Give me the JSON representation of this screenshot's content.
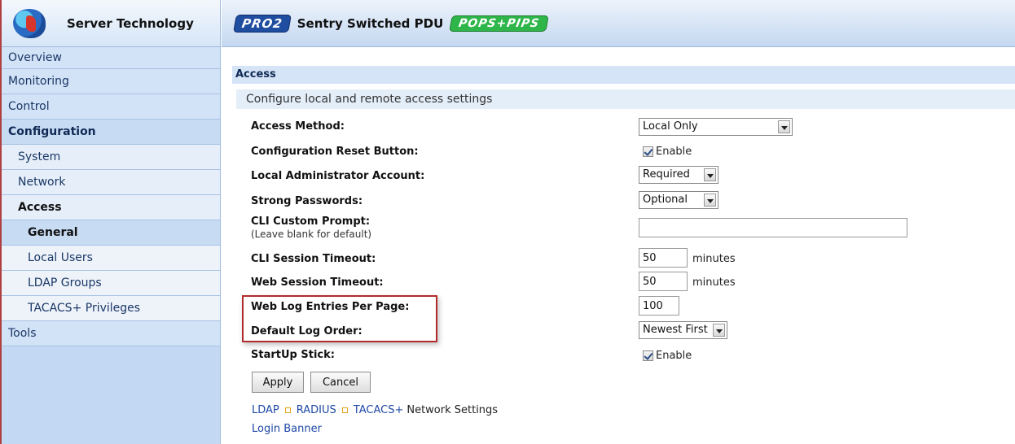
{
  "brand": {
    "name": "Server Technology"
  },
  "header": {
    "pro_badge": "PRO2",
    "title": "Sentry Switched PDU",
    "pops_badge": "POPS+PIPS"
  },
  "sidebar": {
    "items": [
      {
        "label": "Overview"
      },
      {
        "label": "Monitoring"
      },
      {
        "label": "Control"
      },
      {
        "label": "Configuration"
      },
      {
        "label": "System"
      },
      {
        "label": "Network"
      },
      {
        "label": "Access"
      },
      {
        "label": "General"
      },
      {
        "label": "Local Users"
      },
      {
        "label": "LDAP Groups"
      },
      {
        "label": "TACACS+ Privileges"
      },
      {
        "label": "Tools"
      }
    ]
  },
  "main": {
    "section_title": "Access",
    "section_subtitle": "Configure local and remote access settings",
    "fields": {
      "access_method": {
        "label": "Access Method:",
        "value": "Local Only"
      },
      "config_reset": {
        "label": "Configuration Reset Button:",
        "checkbox_label": "Enable",
        "checked": true
      },
      "local_admin": {
        "label": "Local Administrator Account:",
        "value": "Required"
      },
      "strong_pw": {
        "label": "Strong Passwords:",
        "value": "Optional"
      },
      "cli_prompt": {
        "label": "CLI Custom Prompt:",
        "hint": "(Leave blank for default)",
        "value": ""
      },
      "cli_timeout": {
        "label": "CLI Session Timeout:",
        "value": "50",
        "unit": "minutes"
      },
      "web_timeout": {
        "label": "Web Session Timeout:",
        "value": "50",
        "unit": "minutes"
      },
      "log_entries": {
        "label": "Web Log Entries Per Page:",
        "value": "100"
      },
      "log_order": {
        "label": "Default Log Order:",
        "value": "Newest First"
      },
      "startup_stick": {
        "label": "StartUp Stick:",
        "checkbox_label": "Enable",
        "checked": true
      }
    },
    "buttons": {
      "apply": "Apply",
      "cancel": "Cancel"
    },
    "links": {
      "ldap": "LDAP",
      "radius": "RADIUS",
      "tacacs": "TACACS+",
      "suffix": "Network Settings",
      "login_banner": "Login Banner"
    }
  },
  "colors": {
    "highlight": "#b22b2b",
    "link": "#1f49a5",
    "sidebar_bg": "#c3d9f3"
  }
}
